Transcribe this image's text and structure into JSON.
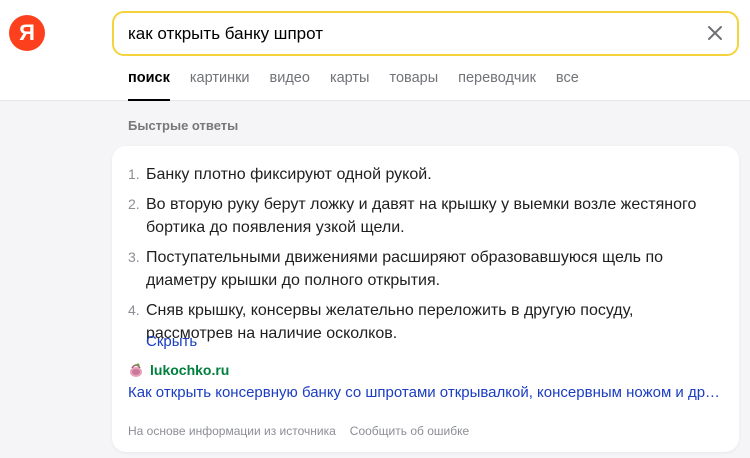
{
  "logo": {
    "letter": "Я"
  },
  "search": {
    "query": "как открыть банку шпрот",
    "clear_icon": "close-icon"
  },
  "tabs": [
    {
      "label": "поиск",
      "active": true
    },
    {
      "label": "картинки",
      "active": false
    },
    {
      "label": "видео",
      "active": false
    },
    {
      "label": "карты",
      "active": false
    },
    {
      "label": "товары",
      "active": false
    },
    {
      "label": "переводчик",
      "active": false
    },
    {
      "label": "все",
      "active": false
    }
  ],
  "quick_answers": {
    "title": "Быстрые ответы",
    "steps": [
      {
        "num": "1.",
        "text": "Банку плотно фиксируют одной рукой."
      },
      {
        "num": "2.",
        "text": "Во вторую руку берут ложку и давят на крышку у выемки возле жестяного бортика до появления узкой щели."
      },
      {
        "num": "3.",
        "text": "Поступательными движениями расширяют образовавшуюся щель по диаметру крышки до полного открытия."
      },
      {
        "num": "4.",
        "text": "Сняв крышку, консервы желательно переложить в другую посуду, рассмотрев на наличие осколков."
      }
    ],
    "hide_label": "Скрыть",
    "source": {
      "domain": "lukochko.ru",
      "title": "Как открыть консервную банку со шпротами открывалкой, консервным ножом и другими подручными средствами"
    },
    "footer": {
      "based_on": "На основе информации из источника",
      "report": "Сообщить об ошибке"
    }
  },
  "colors": {
    "brand": "#fc3f1d",
    "search_border": "#f5d33c",
    "link": "#1a3dc1",
    "source_green": "#007f3d"
  }
}
